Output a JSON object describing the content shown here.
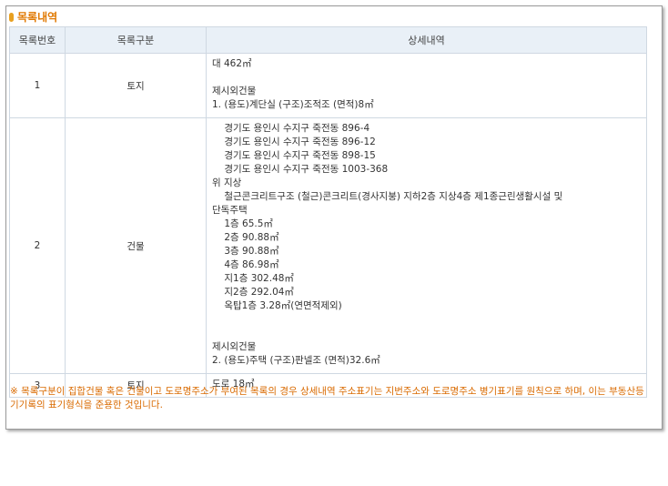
{
  "section_title": "목록내역",
  "colors": {
    "accent": "#e07800",
    "header_bg": "#e9f0f7",
    "border": "#cfd8e2"
  },
  "table": {
    "headers": [
      "목록번호",
      "목록구분",
      "상세내역"
    ],
    "rows": [
      {
        "num": "1",
        "kind": "토지",
        "lines": [
          "대 462㎡",
          "",
          "제시외건물",
          "1. (용도)계단실 (구조)조적조 (면적)8㎡"
        ]
      },
      {
        "num": "2",
        "kind": "건물",
        "lines": [
          "    경기도 용인시 수지구 죽전동 896-4",
          "    경기도 용인시 수지구 죽전동 896-12",
          "    경기도 용인시 수지구 죽전동 898-15",
          "    경기도 용인시 수지구 죽전동 1003-368",
          "위 지상",
          "    철근콘크리트구조 (철근)콘크리트(경사지붕) 지하2층 지상4층 제1종근린생활시설 및",
          "단독주택",
          "    1층 65.5㎡",
          "    2층 90.88㎡",
          "    3층 90.88㎡",
          "    4층 86.98㎡",
          "    지1층 302.48㎡",
          "    지2층 292.04㎡",
          "    옥탑1층 3.28㎡(연면적제외)",
          "",
          "",
          "제시외건물",
          "2. (용도)주택 (구조)판넬조 (면적)32.6㎡"
        ]
      },
      {
        "num": "3",
        "kind": "토지",
        "lines": [
          "도로 18㎡"
        ]
      }
    ]
  },
  "note": "※ 목록구분이 집합건물 혹은 건물이고 도로명주소가 부여된 목록의 경우 상세내역 주소표기는 지번주소와 도로명주소 병기표기를 원칙으로 하며, 이는 부동산등기기록의 표기형식을 준용한 것입니다."
}
